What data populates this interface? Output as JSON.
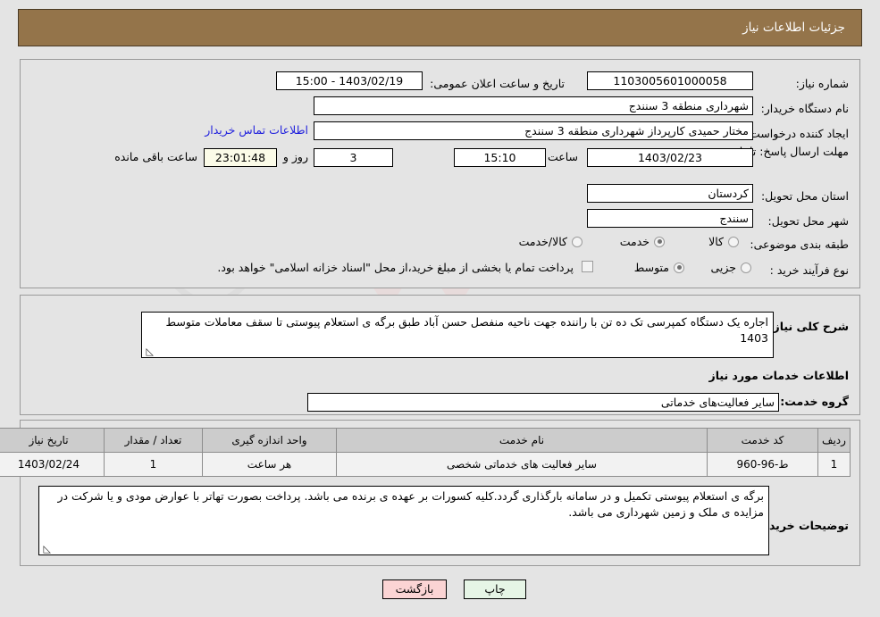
{
  "header": {
    "title": "جزئیات اطلاعات نیاز"
  },
  "form": {
    "need_number_label": "شماره نیاز:",
    "need_number_value": "1103005601000058",
    "announce_label": "تاریخ و ساعت اعلان عمومی:",
    "announce_value": "15:00 - 1403/02/19",
    "buyer_org_label": "نام دستگاه خریدار:",
    "buyer_org_value": "شهرداری منطقه 3 سنندج",
    "creator_label": "ایجاد کننده درخواست:",
    "creator_value": "مختار حمیدی کارپرداز شهرداری منطقه 3 سنندج",
    "contact_link": "اطلاعات تماس خریدار",
    "deadline_label": "مهلت ارسال پاسخ: تا تاریخ:",
    "deadline_date": "1403/02/23",
    "hour_label": "ساعت",
    "hour_value": "15:10",
    "days_value": "3",
    "days_label": "روز و",
    "countdown_value": "23:01:48",
    "countdown_label": "ساعت باقی مانده",
    "province_label": "استان محل تحویل:",
    "province_value": "کردستان",
    "city_label": "شهر محل تحویل:",
    "city_value": "سنندج",
    "category_label": "طبقه بندی موضوعی:",
    "category_options": [
      {
        "label": "کالا",
        "selected": false
      },
      {
        "label": "خدمت",
        "selected": true
      },
      {
        "label": "کالا/خدمت",
        "selected": false
      }
    ],
    "process_label": "نوع فرآیند خرید :",
    "process_options": [
      {
        "label": "جزیی",
        "selected": false
      },
      {
        "label": "متوسط",
        "selected": true
      }
    ],
    "treasury_checkbox_checked": false,
    "treasury_text": "پرداخت تمام یا بخشی از مبلغ خرید،از محل \"اسناد خزانه اسلامی\" خواهد بود."
  },
  "description": {
    "label": "شرح کلی نیاز:",
    "value": "اجاره یک دستگاه کمپرسی تک ده تن با راننده جهت  ناحیه منفصل حسن آباد طبق برگه ی استعلام پیوستی تا سقف معاملات متوسط 1403",
    "section_title": "اطلاعات خدمات مورد نیاز",
    "service_group_label": "گروه خدمت:",
    "service_group_value": "سایر فعالیت‌های خدماتی"
  },
  "table": {
    "headers": [
      "ردیف",
      "کد خدمت",
      "نام خدمت",
      "واحد اندازه گیری",
      "تعداد / مقدار",
      "تاریخ نیاز"
    ],
    "rows": [
      {
        "row": "1",
        "code": "ط-96-960",
        "name": "سایر فعالیت های خدماتی شخصی",
        "unit": "هر ساعت",
        "qty": "1",
        "date": "1403/02/24"
      }
    ]
  },
  "remarks": {
    "label": "توضیحات خریدار:",
    "value": "برگه ی استعلام پیوستی تکمیل و در سامانه بارگذاری گردد.کلیه کسورات بر عهده ی برنده می باشد. پرداخت بصورت تهاتر با عوارض مودی و یا شرکت در مزایده ی ملک و زمین شهرداری می باشد."
  },
  "footer": {
    "back_label": "بازگشت",
    "print_label": "چاپ"
  },
  "watermark": {
    "text": "AriaTender.net"
  },
  "colors": {
    "header_bg": "#94744a",
    "page_bg": "#e4e4e4",
    "link": "#2222dd",
    "back_btn": "#fbd4d4",
    "print_btn": "#e6f5e6",
    "countdown_bg": "#fbfbe8",
    "table_header_bg": "#cccccc"
  }
}
